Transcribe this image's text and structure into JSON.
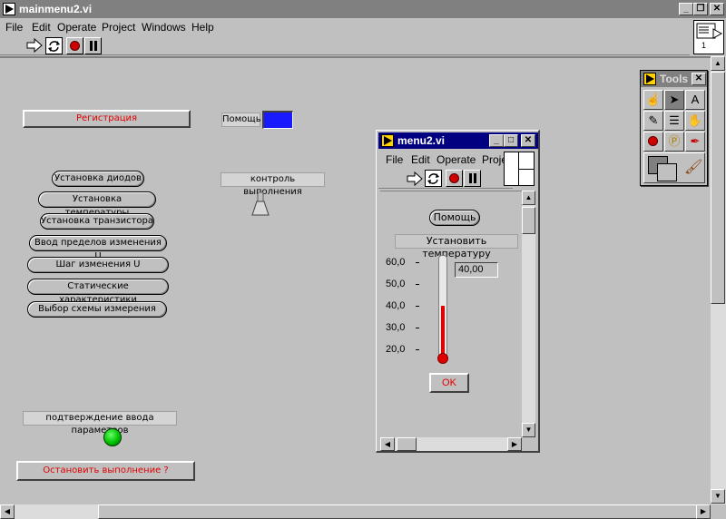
{
  "window": {
    "title": "mainmenu2.vi",
    "menu": [
      "File",
      "Edit",
      "Operate",
      "Project",
      "Windows",
      "Help"
    ],
    "connector_label": "1"
  },
  "panel": {
    "registration_button": "Регистрация",
    "help_label": "Помощь",
    "help_color": "#1a1aff",
    "menu_buttons": [
      "Установка диодов",
      "Установка температуры",
      "Установка транзистора",
      "Ввод пределов изменения U",
      "Шаг изменения U",
      "Статические характеристики",
      "Выбор схемы измерения"
    ],
    "execution_control_label": "контроль выполнения",
    "confirm_label": "подтверждение ввода параметров",
    "stop_button": "Остановить выполнение ?"
  },
  "tools": {
    "title": "Tools"
  },
  "subwindow": {
    "title": "menu2.vi",
    "menu": [
      "File",
      "Edit",
      "Operate",
      "Proje"
    ],
    "help_button": "Помощь",
    "set_temp_label": "Установить температуру",
    "thermometer": {
      "ticks": [
        "60,0",
        "50,0",
        "40,0",
        "30,0",
        "20,0"
      ],
      "value": 40,
      "min": 20,
      "max": 60
    },
    "value_display": "40,00",
    "ok_button": "OK"
  }
}
